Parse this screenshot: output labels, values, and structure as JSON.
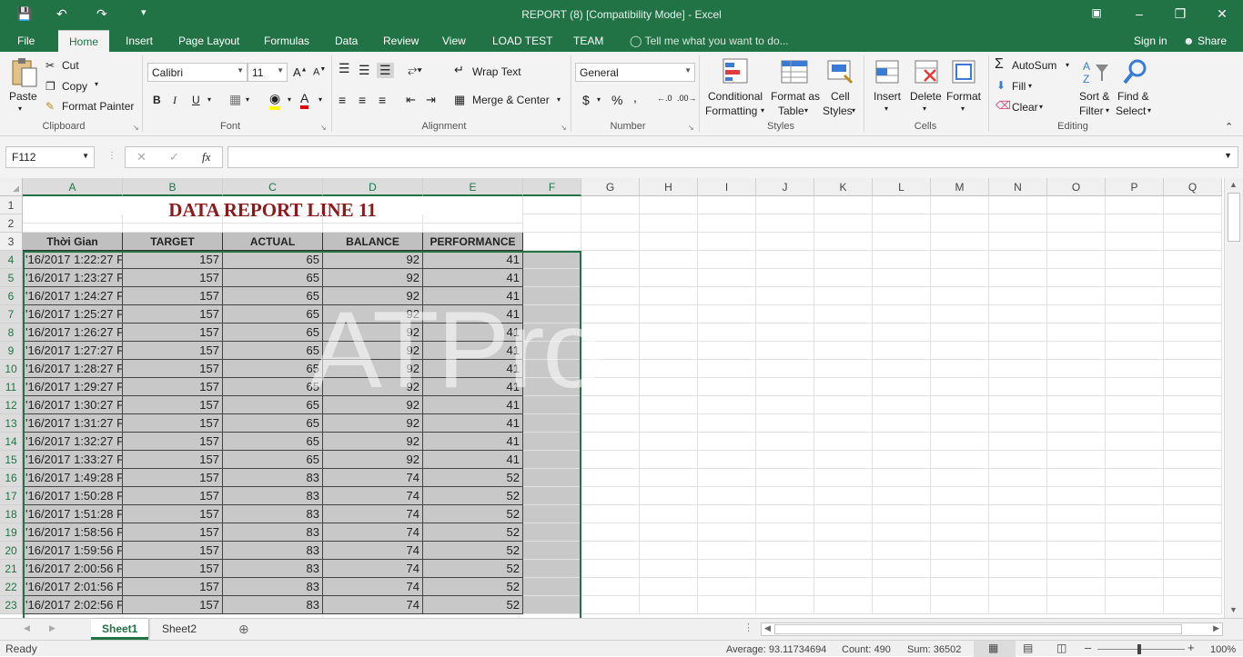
{
  "title": "REPORT (8)  [Compatibility Mode] - Excel",
  "tabs": [
    "File",
    "Home",
    "Insert",
    "Page Layout",
    "Formulas",
    "Data",
    "Review",
    "View",
    "LOAD TEST",
    "TEAM"
  ],
  "tell_me": "Tell me what you want to do...",
  "sign_in": "Sign in",
  "share": "Share",
  "clipboard": {
    "paste": "Paste",
    "cut": "Cut",
    "copy": "Copy",
    "format_painter": "Format Painter",
    "label": "Clipboard"
  },
  "font": {
    "name": "Calibri",
    "size": "11",
    "label": "Font",
    "bold": "B",
    "italic": "I",
    "underline": "U"
  },
  "alignment": {
    "wrap": "Wrap Text",
    "merge": "Merge & Center",
    "label": "Alignment"
  },
  "number": {
    "format": "General",
    "label": "Number",
    "currency": "$",
    "percent": "%",
    "comma": ","
  },
  "styles": {
    "conditional": "Conditional",
    "conditional2": "Formatting",
    "format_as": "Format as",
    "format_as2": "Table",
    "cell": "Cell",
    "cell2": "Styles",
    "label": "Styles"
  },
  "cells": {
    "insert": "Insert",
    "delete": "Delete",
    "format": "Format",
    "label": "Cells"
  },
  "editing": {
    "autosum": "AutoSum",
    "fill": "Fill",
    "clear": "Clear",
    "sort": "Sort &",
    "sort2": "Filter",
    "find": "Find &",
    "find2": "Select",
    "label": "Editing"
  },
  "name_box": "F112",
  "fx": "fx",
  "columns": [
    "A",
    "B",
    "C",
    "D",
    "E",
    "F",
    "G",
    "H",
    "I",
    "J",
    "K",
    "L",
    "M",
    "N",
    "O",
    "P",
    "Q"
  ],
  "sheet_title": "DATA REPORT LINE 11",
  "headers": [
    "Thời Gian",
    "TARGET",
    "ACTUAL",
    "BALANCE",
    "PERFORMANCE"
  ],
  "rows": [
    [
      "'16/2017 1:22:27 P",
      "157",
      "65",
      "92",
      "41"
    ],
    [
      "'16/2017 1:23:27 P",
      "157",
      "65",
      "92",
      "41"
    ],
    [
      "'16/2017 1:24:27 P",
      "157",
      "65",
      "92",
      "41"
    ],
    [
      "'16/2017 1:25:27 P",
      "157",
      "65",
      "92",
      "41"
    ],
    [
      "'16/2017 1:26:27 P",
      "157",
      "65",
      "92",
      "41"
    ],
    [
      "'16/2017 1:27:27 P",
      "157",
      "65",
      "92",
      "41"
    ],
    [
      "'16/2017 1:28:27 P",
      "157",
      "65",
      "92",
      "41"
    ],
    [
      "'16/2017 1:29:27 P",
      "157",
      "65",
      "92",
      "41"
    ],
    [
      "'16/2017 1:30:27 P",
      "157",
      "65",
      "92",
      "41"
    ],
    [
      "'16/2017 1:31:27 P",
      "157",
      "65",
      "92",
      "41"
    ],
    [
      "'16/2017 1:32:27 P",
      "157",
      "65",
      "92",
      "41"
    ],
    [
      "'16/2017 1:33:27 P",
      "157",
      "65",
      "92",
      "41"
    ],
    [
      "'16/2017 1:49:28 P",
      "157",
      "83",
      "74",
      "52"
    ],
    [
      "'16/2017 1:50:28 P",
      "157",
      "83",
      "74",
      "52"
    ],
    [
      "'16/2017 1:51:28 P",
      "157",
      "83",
      "74",
      "52"
    ],
    [
      "'16/2017 1:58:56 P",
      "157",
      "83",
      "74",
      "52"
    ],
    [
      "'16/2017 1:59:56 P",
      "157",
      "83",
      "74",
      "52"
    ],
    [
      "'16/2017 2:00:56 P",
      "157",
      "83",
      "74",
      "52"
    ],
    [
      "'16/2017 2:01:56 P",
      "157",
      "83",
      "74",
      "52"
    ],
    [
      "'16/2017 2:02:56 P",
      "157",
      "83",
      "74",
      "52"
    ]
  ],
  "sheets": [
    "Sheet1",
    "Sheet2"
  ],
  "status": {
    "ready": "Ready",
    "average": "Average: 93.11734694",
    "count": "Count: 490",
    "sum": "Sum: 36502",
    "zoom": "100%"
  },
  "colors": {
    "brand": "#217346",
    "selection": "#c8c8c8",
    "title_red": "#8b1a1a"
  }
}
